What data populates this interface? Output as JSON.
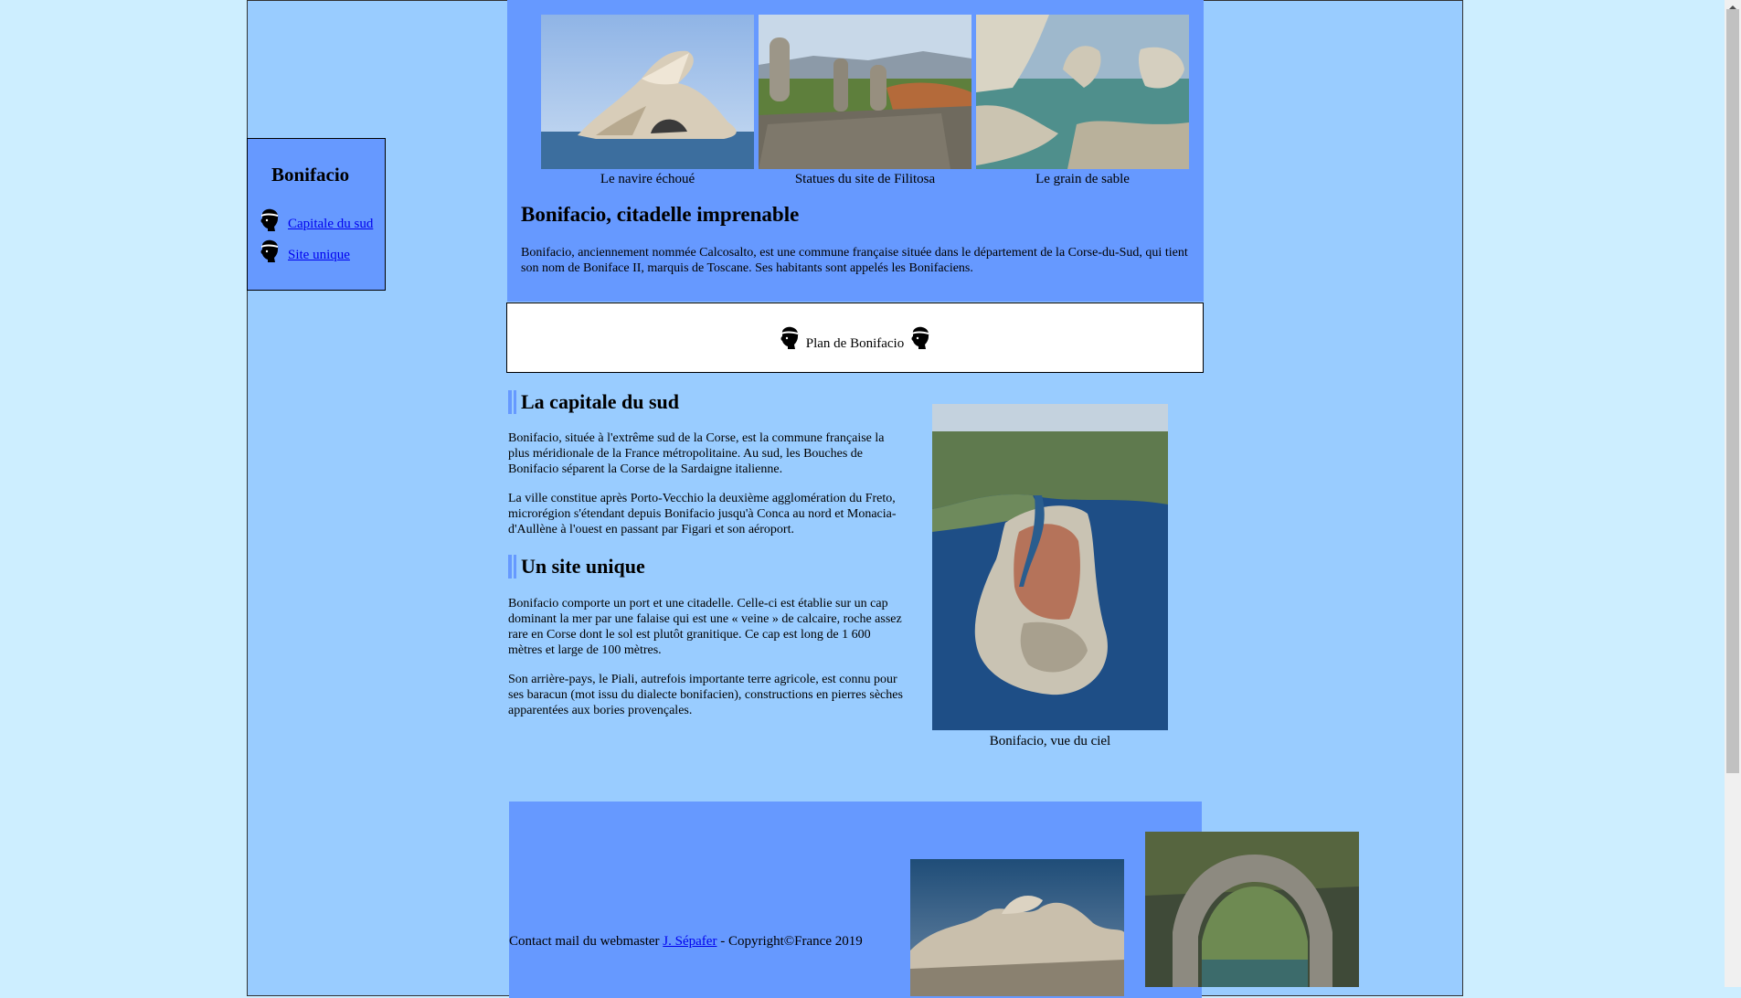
{
  "sidebar": {
    "title": "Bonifacio",
    "links": [
      {
        "label": "Capitale du sud",
        "icon": "moor-head-icon"
      },
      {
        "label": "Site unique",
        "icon": "moor-head-icon"
      }
    ]
  },
  "header": {
    "photos": [
      {
        "caption": "Le navire échoué"
      },
      {
        "caption": "Statues du site de Filitosa"
      },
      {
        "caption": "Le grain de sable"
      }
    ],
    "title": "Bonifacio, citadelle imprenable",
    "intro": "Bonifacio, anciennement nommée Calcosalto, est une commune française située dans le département de la Corse-du-Sud, qui tient son nom de Boniface II, marquis de Toscane. Ses habitants sont appelés les Bonifaciens."
  },
  "plan": {
    "label": "Plan de Bonifacio"
  },
  "sections": {
    "capitale": {
      "title": "La capitale du sud",
      "p1": "Bonifacio, située à l'extrême sud de la Corse, est la commune française la plus méridionale de la France métropolitaine. Au sud, les Bouches de Bonifacio séparent la Corse de la Sardaigne italienne.",
      "p2": "La ville constitue après Porto-Vecchio la deuxième agglomération du Freto, microrégion s'étendant depuis Bonifacio jusqu'à Conca au nord et Monacia-d'Aullène à l'ouest en passant par Figari et son aéroport."
    },
    "site": {
      "title": "Un site unique",
      "p1": "Bonifacio comporte un port et une citadelle. Celle-ci est établie sur un cap dominant la mer par une falaise qui est une « veine » de calcaire, roche assez rare en Corse dont le sol est plutôt granitique. Ce cap est long de 1 600 mètres et large de 100 mètres.",
      "p2": "Son arrière-pays, le Piali, autrefois importante terre agricole, est connu pour ses baracun (mot issu du dialecte bonifacien), constructions en pierres sèches apparentées aux bories provençales."
    }
  },
  "aerial": {
    "caption": "Bonifacio, vue du ciel"
  },
  "footer": {
    "prefix": "Contact mail du webmaster ",
    "link": "J. Sépafer",
    "suffix": " - Copyright©France 2019"
  },
  "colors": {
    "page_bg": "#cdeeff",
    "frame_bg": "#99ccff",
    "accent": "#6699ff",
    "link": "#0000ee"
  }
}
